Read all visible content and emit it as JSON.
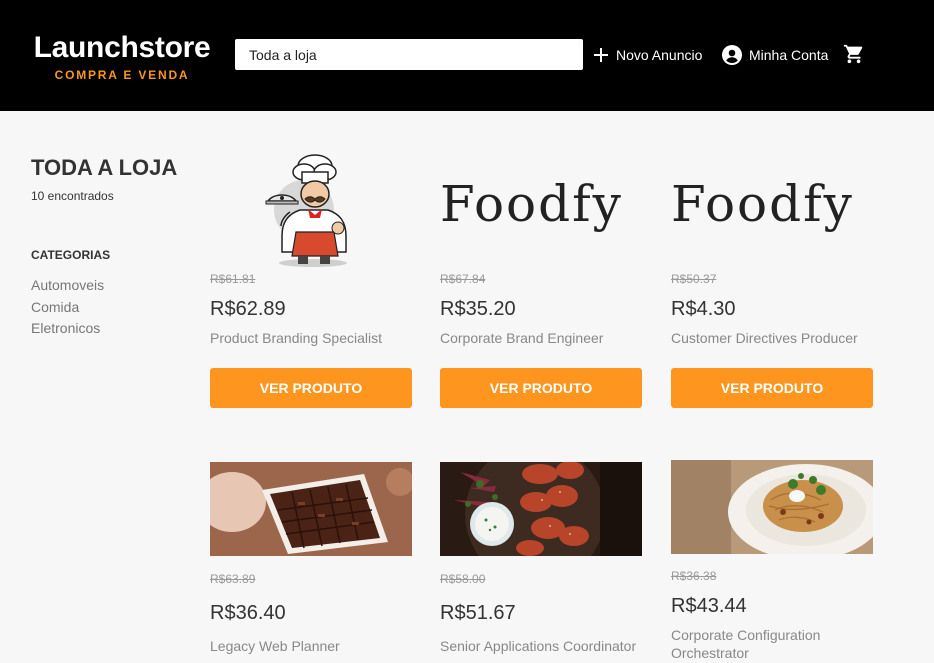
{
  "brand": {
    "title": "Launchstore",
    "subtitle": "COMPRA E VENDA",
    "accent": "#fd951f"
  },
  "search": {
    "value": "Toda a loja"
  },
  "nav": {
    "new_ad": "Novo Anuncio",
    "account": "Minha Conta"
  },
  "sidebar": {
    "title": "TODA A LOJA",
    "count": "10 encontrados",
    "categories_title": "CATEGORIAS",
    "categories": [
      "Automoveis",
      "Comida",
      "Eletronicos"
    ]
  },
  "products": [
    {
      "image": "chef-illustration",
      "old_price": "R$61.81",
      "price": "R$62.89",
      "name": "Product Branding Specialist",
      "button": "VER PRODUTO"
    },
    {
      "image": "foodfy-logo",
      "image_text": "Foodfy",
      "old_price": "R$67.84",
      "price": "R$35.20",
      "name": "Corporate Brand Engineer",
      "button": "VER PRODUTO"
    },
    {
      "image": "foodfy-logo",
      "image_text": "Foodfy",
      "old_price": "R$50.37",
      "price": "R$4.30",
      "name": "Customer Directives Producer",
      "button": "VER PRODUTO"
    },
    {
      "image": "chocolate-box-photo",
      "old_price": "R$63.89",
      "price": "R$36.40",
      "name": "Legacy Web Planner"
    },
    {
      "image": "chicken-wings-photo",
      "old_price": "R$58.00",
      "price": "R$51.67",
      "name": "Senior Applications Coordinator"
    },
    {
      "image": "pasta-plate-photo",
      "old_price": "R$36.38",
      "price": "R$43.44",
      "name": "Corporate Configuration Orchestrator"
    }
  ]
}
